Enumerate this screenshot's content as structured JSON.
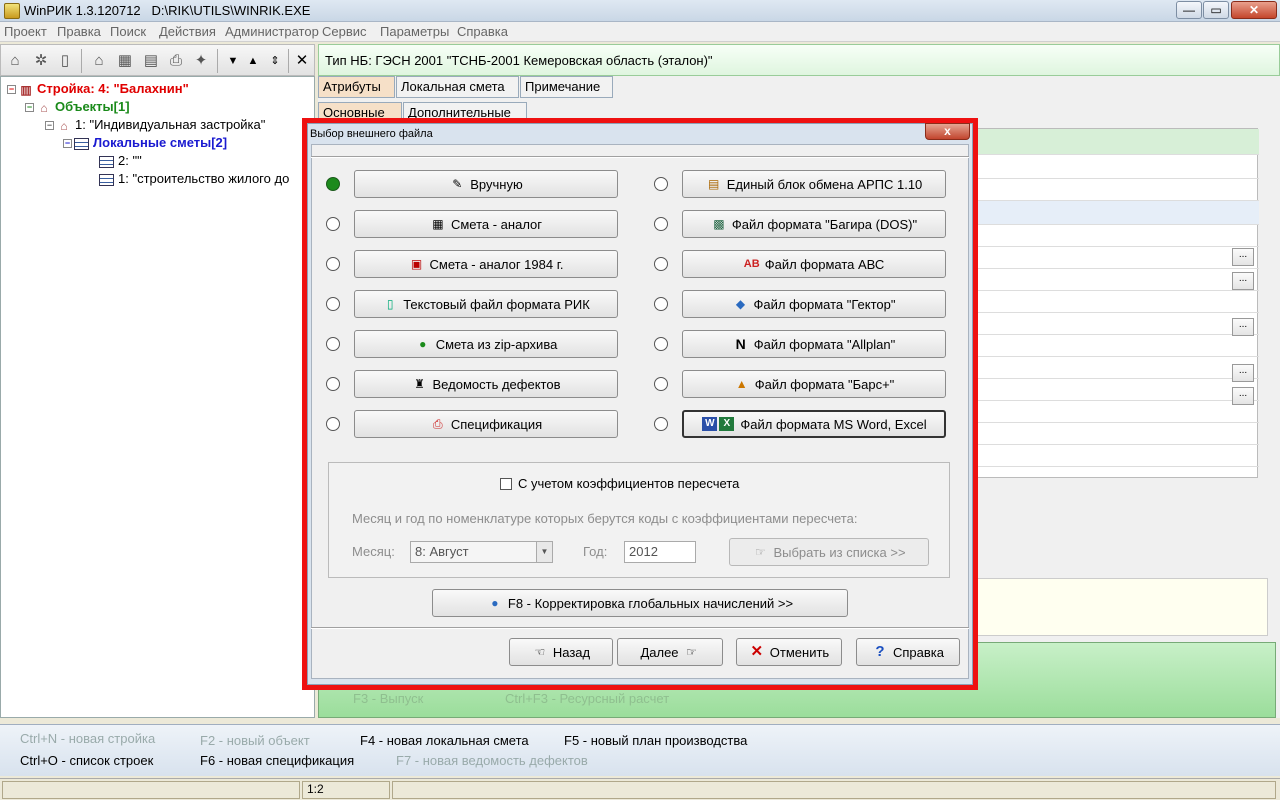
{
  "window": {
    "title": "WinРИК 1.3.120712",
    "path": "D:\\RIK\\UTILS\\WINRIK.EXE",
    "minimize": "—",
    "restore": "▭",
    "close": "✕"
  },
  "menu": [
    "Проект",
    "Правка",
    "Поиск",
    "Действия",
    "Администратор",
    "Сервис",
    "Параметры",
    "Справка"
  ],
  "tree": {
    "root": "Стройка: 4: \"Балахнин\"",
    "objects": "Объекты[1]",
    "object1": "1: \"Индивидуальная застройка\"",
    "local_estimates": "Локальные сметы[2]",
    "estimate2": "2: \"\"",
    "estimate1": "1: \"строительство жилого до"
  },
  "right": {
    "nb_type": "Тип НБ: ГЭСН 2001 \"ТСНБ-2001 Кемеровская область (эталон)\"",
    "tabs": [
      "Атрибуты",
      "Локальная смета",
      "Примечание"
    ],
    "subtabs": [
      "Основные",
      "Дополнительные"
    ],
    "ghost_f3": "F3 - Выпуск",
    "ghost_ctrlf3": "Ctrl+F3 - Ресурсный расчет",
    "dots": "..."
  },
  "dialog": {
    "title": "Выбор внешнего файла",
    "close": "x",
    "left_options": [
      "Вручную",
      "Смета - аналог",
      "Смета - аналог 1984 г.",
      "Текстовый файл формата РИК",
      "Смета из zip-архива",
      "Ведомость дефектов",
      "Спецификация"
    ],
    "right_options": [
      "Единый блок обмена АРПС 1.10",
      "Файл формата \"Багира (DOS)\"",
      "Файл формата АВС",
      "Файл формата \"Гектор\"",
      "Файл формата \"Allplan\"",
      "Файл формата \"Барс+\"",
      "Файл формата MS Word, Excel"
    ],
    "recalc_checkbox": "С учетом коэффициентов пересчета",
    "recalc_hint": "Месяц и год по номенклатуре которых берутся коды  с коэффициентами пересчета:",
    "month_label": "Месяц:",
    "month_value": "8: Август",
    "year_label": "Год:",
    "year_value": "2012",
    "pick_list": "Выбрать из списка >>",
    "global_btn": "F8 - Корректировка глобальных начислений >>",
    "back": "Назад",
    "next": "Далее",
    "cancel": "Отменить",
    "help": "Справка"
  },
  "hints": {
    "ctrl_n": "Ctrl+N - новая стройка",
    "f2": "F2 - новый объект",
    "f4": "F4 - новая локальная смета",
    "f5": "F5 - новый план производства",
    "ctrl_o": "Ctrl+O - список строек",
    "f6": "F6 - новая спецификация",
    "f7": "F7 - новая ведомость дефектов"
  },
  "status": {
    "position": "1:2"
  },
  "icons": {
    "manual": "pencil-icon",
    "analog": "table-icon",
    "radio_selected_color": "#1c8a1c",
    "frame_color": "#ee1111"
  }
}
